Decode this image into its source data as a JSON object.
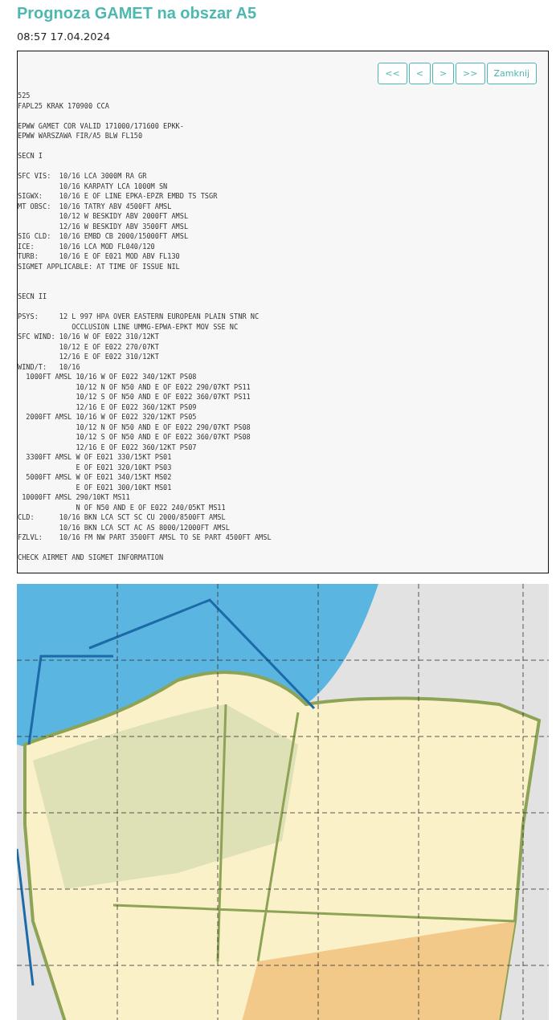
{
  "title": "Prognoza GAMET na obszar A5",
  "timestamp": "08:57 17.04.2024",
  "buttons": [
    {
      "label": "<<"
    },
    {
      "label": "<"
    },
    {
      "label": ">"
    },
    {
      "label": ">>"
    },
    {
      "label": "Zamknij"
    }
  ],
  "bulletin": [
    {
      "extra_gap": false,
      "lines": [
        "525",
        "FAPL25 KRAK 170900 CCA"
      ]
    },
    {
      "extra_gap": false,
      "lines": [
        "EPWW GAMET COR VALID 171000/171600 EPKK-",
        "EPWW WARSZAWA FIR/A5 BLW FL150"
      ]
    },
    {
      "extra_gap": false,
      "lines": [
        "SECN I"
      ]
    },
    {
      "extra_gap": false,
      "lines": [
        "SFC VIS:  10/16 LCA 3000M RA GR",
        "          10/16 KARPATY LCA 1000M SN",
        "SIGWX:    10/16 E OF LINE EPKA-EPZR EMBD TS TSGR",
        "MT OBSC:  10/16 TATRY ABV 4500FT AMSL",
        "          10/12 W BESKIDY ABV 2000FT AMSL",
        "          12/16 W BESKIDY ABV 3500FT AMSL",
        "SIG CLD:  10/16 EMBD CB 2000/15000FT AMSL",
        "ICE:      10/16 LCA MOD FL040/120",
        "TURB:     10/16 E OF E021 MOD ABV FL130",
        "SIGMET APPLICABLE: AT TIME OF ISSUE NIL"
      ]
    },
    {
      "extra_gap": true,
      "lines": [
        "SECN II"
      ]
    },
    {
      "extra_gap": false,
      "lines": [
        "PSYS:     12 L 997 HPA OVER EASTERN EUROPEAN PLAIN STNR NC",
        "             OCCLUSION LINE UMMG-EPWA-EPKT MOV SSE NC",
        "SFC WIND: 10/16 W OF E022 310/12KT",
        "          10/12 E OF E022 270/07KT",
        "          12/16 E OF E022 310/12KT",
        "WIND/T:   10/16",
        "  1000FT AMSL 10/16 W OF E022 340/12KT PS08",
        "              10/12 N OF N50 AND E OF E022 290/07KT PS11",
        "              10/12 S OF N50 AND E OF E022 360/07KT PS11",
        "              12/16 E OF E022 360/12KT PS09",
        "  2000FT AMSL 10/16 W OF E022 320/12KT PS05",
        "              10/12 N OF N50 AND E OF E022 290/07KT PS08",
        "              10/12 S OF N50 AND E OF E022 360/07KT PS08",
        "              12/16 E OF E022 360/12KT PS07",
        "  3300FT AMSL W OF E021 330/15KT PS01",
        "              E OF E021 320/10KT PS03",
        "  5000FT AMSL W OF E021 340/15KT MS02",
        "              E OF E021 300/10KT MS01",
        " 10000FT AMSL 290/10KT MS11",
        "              N OF N50 AND E OF E022 240/05KT MS11",
        "CLD:      10/16 BKN LCA SCT SC CU 2000/8500FT AMSL",
        "          10/16 BKN LCA SCT AC AS 8000/12000FT AMSL",
        "FZLVL:    10/16 FM NW PART 3500FT AMSL TO SE PART 4500FT AMSL"
      ]
    },
    {
      "extra_gap": false,
      "lines": [
        "CHECK AIRMET AND SIGMET INFORMATION"
      ]
    }
  ]
}
